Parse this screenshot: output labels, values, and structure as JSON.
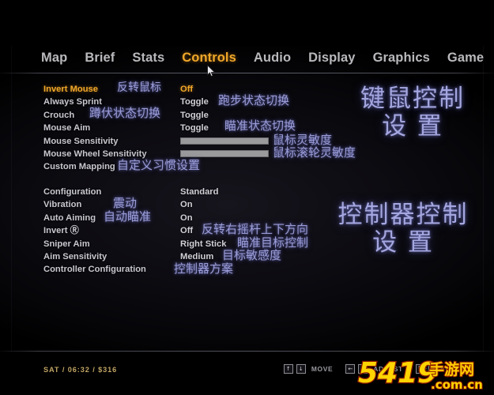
{
  "nav": {
    "items": [
      {
        "label": "Map",
        "active": false
      },
      {
        "label": "Brief",
        "active": false
      },
      {
        "label": "Stats",
        "active": false
      },
      {
        "label": "Controls",
        "active": true
      },
      {
        "label": "Audio",
        "active": false
      },
      {
        "label": "Display",
        "active": false
      },
      {
        "label": "Graphics",
        "active": false
      },
      {
        "label": "Game",
        "active": false
      }
    ]
  },
  "keyboard_mouse": {
    "annotation": "键鼠控制\n设置",
    "annotation_line1": "键鼠控制",
    "annotation_line2": "设 置",
    "rows": [
      {
        "label": "Invert Mouse",
        "value": "Off",
        "type": "text",
        "highlight": true,
        "cn_label": "反转鼠标",
        "cn_value": ""
      },
      {
        "label": "Always Sprint",
        "value": "Toggle",
        "type": "text",
        "highlight": false,
        "cn_label": "",
        "cn_value": "跑步状态切换"
      },
      {
        "label": "Crouch",
        "value": "Toggle",
        "type": "text",
        "highlight": false,
        "cn_label": "蹲伏状态切换",
        "cn_value": ""
      },
      {
        "label": "Mouse Aim",
        "value": "Toggle",
        "type": "text",
        "highlight": false,
        "cn_label": "",
        "cn_value": "瞄准状态切换"
      },
      {
        "label": "Mouse Sensitivity",
        "value": "",
        "type": "slider",
        "highlight": false,
        "cn_label": "",
        "cn_value": "鼠标灵敏度",
        "fill_percent": 100
      },
      {
        "label": "Mouse Wheel Sensitivity",
        "value": "",
        "type": "slider",
        "highlight": false,
        "cn_label": "",
        "cn_value": "鼠标滚轮灵敏度",
        "fill_percent": 100
      },
      {
        "label": "Custom Mapping",
        "value": "",
        "type": "text",
        "highlight": false,
        "cn_label": "自定义习惯设置",
        "cn_value": ""
      }
    ]
  },
  "controller": {
    "annotation_line1": "控制器控制",
    "annotation_line2": "设 置",
    "rows": [
      {
        "label": "Configuration",
        "value": "Standard",
        "type": "text",
        "highlight": false,
        "cn_label": "",
        "cn_value": ""
      },
      {
        "label": "Vibration",
        "value": "On",
        "type": "text",
        "highlight": false,
        "cn_label": "震动",
        "cn_value": ""
      },
      {
        "label": "Auto Aiming",
        "value": "On",
        "type": "text",
        "highlight": false,
        "cn_label": "自动瞄准",
        "cn_value": ""
      },
      {
        "label": "Invert Ⓡ",
        "value": "Off",
        "type": "text",
        "highlight": false,
        "cn_label": "",
        "cn_value": "反转右摇杆上下方向"
      },
      {
        "label": "Sniper Aim",
        "value": "Right Stick",
        "type": "text",
        "highlight": false,
        "cn_label": "",
        "cn_value": "瞄准目标控制"
      },
      {
        "label": "Aim Sensitivity",
        "value": "Medium",
        "type": "text",
        "highlight": false,
        "cn_label": "",
        "cn_value": "目标敏感度"
      },
      {
        "label": "Controller Configuration",
        "value": "",
        "type": "text",
        "highlight": false,
        "cn_label": "",
        "cn_value": "控制器方案"
      }
    ]
  },
  "hud": {
    "status": "SAT  /  06:32  /  $316",
    "hints": [
      {
        "keys": [
          "↑",
          "↓"
        ],
        "label": "MOVE"
      },
      {
        "keys": [
          "←",
          "→"
        ],
        "label": "ADJUST"
      },
      {
        "keys": [
          "ESC"
        ],
        "label": "BACK"
      }
    ]
  },
  "watermark": {
    "text_main": "5419",
    "text_cn": "手游网",
    "text_domain": ".com.cn"
  },
  "colors": {
    "accent": "#f0a829",
    "label": "#c8c8cf",
    "annotation": "#9a9cd6",
    "hud_status": "#c0a463",
    "slider": "#9a9a9c"
  }
}
